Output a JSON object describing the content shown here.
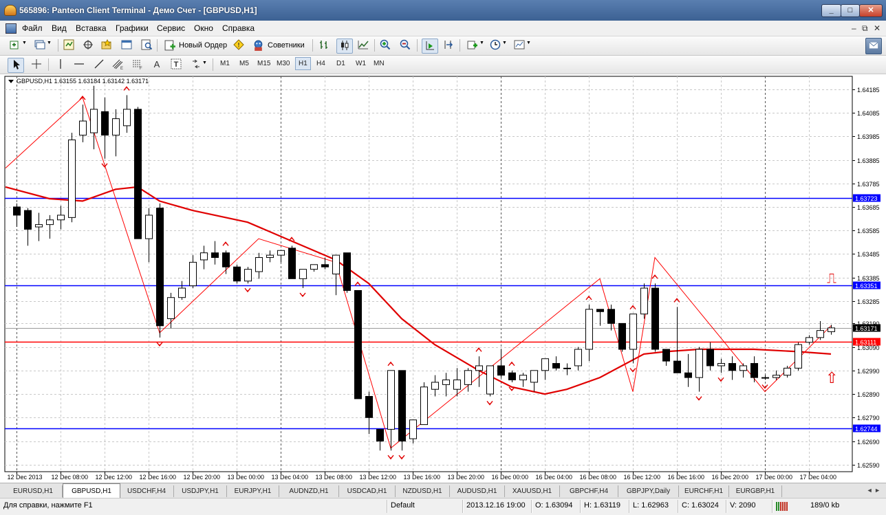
{
  "window": {
    "title": "565896: Panteon Client Terminal - Демо Счет - [GBPUSD,H1]"
  },
  "window_controls": {
    "minimize": "_",
    "maximize": "□",
    "close": "✕"
  },
  "menu": [
    "Файл",
    "Вид",
    "Вставка",
    "Графики",
    "Сервис",
    "Окно",
    "Справка"
  ],
  "mdi_controls": [
    "–",
    "⧉",
    "✕"
  ],
  "toolbar": {
    "new_order": "Новый Ордер",
    "advisors": "Советники"
  },
  "timeframes": [
    "M1",
    "M5",
    "M15",
    "M30",
    "H1",
    "H4",
    "D1",
    "W1",
    "MN"
  ],
  "active_timeframe": "H1",
  "chart_data": {
    "type": "candlestick",
    "header": "GBPUSD,H1  1.63155 1.63184 1.63142 1.63171",
    "price_ticks": [
      "1.64185",
      "1.64085",
      "1.63985",
      "1.63885",
      "1.63785",
      "1.63685",
      "1.63585",
      "1.63485",
      "1.63385",
      "1.63285",
      "1.63190",
      "1.63090",
      "1.62990",
      "1.62890",
      "1.62790",
      "1.62690",
      "1.62590"
    ],
    "x_labels": [
      "12 Dec 2013",
      "12 Dec 08:00",
      "12 Dec 12:00",
      "12 Dec 16:00",
      "12 Dec 20:00",
      "13 Dec 00:00",
      "13 Dec 04:00",
      "13 Dec 08:00",
      "13 Dec 12:00",
      "13 Dec 16:00",
      "13 Dec 20:00",
      "16 Dec 00:00",
      "16 Dec 04:00",
      "16 Dec 08:00",
      "16 Dec 12:00",
      "16 Dec 16:00",
      "16 Dec 20:00",
      "17 Dec 00:00",
      "17 Dec 04:00"
    ],
    "horizontal_lines": [
      {
        "price": 1.63723,
        "label": "1.63723",
        "color": "#0000ff"
      },
      {
        "price": 1.63351,
        "label": "1.63351",
        "color": "#0000ff"
      },
      {
        "price": 1.63111,
        "label": "1.63111",
        "color": "#ff0000"
      },
      {
        "price": 1.62744,
        "label": "1.62744",
        "color": "#0000ff"
      }
    ],
    "current_price": {
      "price": 1.63171,
      "label": "1.63171"
    },
    "ohlc": [
      [
        1.63685,
        1.637,
        1.636,
        1.6365
      ],
      [
        1.6367,
        1.6368,
        1.6352,
        1.6359
      ],
      [
        1.636,
        1.6366,
        1.6354,
        1.6361
      ],
      [
        1.6361,
        1.6365,
        1.6355,
        1.6363
      ],
      [
        1.6363,
        1.6369,
        1.6359,
        1.6365
      ],
      [
        1.6364,
        1.64,
        1.6362,
        1.6397
      ],
      [
        1.6399,
        1.6412,
        1.6396,
        1.6405
      ],
      [
        1.64,
        1.642,
        1.6393,
        1.641
      ],
      [
        1.6409,
        1.6415,
        1.6389,
        1.6399
      ],
      [
        1.6399,
        1.641,
        1.639,
        1.6406
      ],
      [
        1.6403,
        1.6416,
        1.64,
        1.641
      ],
      [
        1.641,
        1.6411,
        1.6355,
        1.6355
      ],
      [
        1.6355,
        1.6368,
        1.6345,
        1.6365
      ],
      [
        1.6368,
        1.637,
        1.6313,
        1.6318
      ],
      [
        1.6321,
        1.6332,
        1.6317,
        1.633
      ],
      [
        1.633,
        1.6337,
        1.6329,
        1.6334
      ],
      [
        1.6335,
        1.6348,
        1.6334,
        1.6345
      ],
      [
        1.6346,
        1.6352,
        1.6342,
        1.6349
      ],
      [
        1.6349,
        1.6354,
        1.6344,
        1.6347
      ],
      [
        1.6349,
        1.635,
        1.634,
        1.6343
      ],
      [
        1.6343,
        1.6344,
        1.6336,
        1.6337
      ],
      [
        1.6337,
        1.6343,
        1.6336,
        1.6342
      ],
      [
        1.6341,
        1.6349,
        1.6338,
        1.6347
      ],
      [
        1.6347,
        1.635,
        1.6345,
        1.6348
      ],
      [
        1.6348,
        1.6349,
        1.6345,
        1.635
      ],
      [
        1.6351,
        1.6352,
        1.6338,
        1.6338
      ],
      [
        1.6338,
        1.6342,
        1.6334,
        1.6342
      ],
      [
        1.6342,
        1.6344,
        1.6341,
        1.6344
      ],
      [
        1.6344,
        1.6347,
        1.6342,
        1.6343
      ],
      [
        1.634,
        1.6348,
        1.6331,
        1.6348
      ],
      [
        1.6349,
        1.6349,
        1.6332,
        1.6333
      ],
      [
        1.6333,
        1.6333,
        1.6287,
        1.6287
      ],
      [
        1.6288,
        1.629,
        1.6272,
        1.6279
      ],
      [
        1.6274,
        1.6274,
        1.6265,
        1.6269
      ],
      [
        1.6274,
        1.6299,
        1.6265,
        1.6299
      ],
      [
        1.6299,
        1.6299,
        1.6265,
        1.6269
      ],
      [
        1.627,
        1.6278,
        1.6268,
        1.6278
      ],
      [
        1.6276,
        1.6294,
        1.6276,
        1.6292
      ],
      [
        1.6291,
        1.6297,
        1.6288,
        1.6294
      ],
      [
        1.6293,
        1.6298,
        1.6288,
        1.6295
      ],
      [
        1.6291,
        1.63,
        1.6288,
        1.6295
      ],
      [
        1.6293,
        1.63,
        1.629,
        1.6299
      ],
      [
        1.6299,
        1.6305,
        1.6292,
        1.6301
      ],
      [
        1.6289,
        1.6301,
        1.6288,
        1.6301
      ],
      [
        1.6301,
        1.6308,
        1.6296,
        1.6297
      ],
      [
        1.6298,
        1.6299,
        1.6294,
        1.6295
      ],
      [
        1.6295,
        1.6298,
        1.6292,
        1.6297
      ],
      [
        1.6294,
        1.6299,
        1.629,
        1.6299
      ],
      [
        1.6299,
        1.6304,
        1.6295,
        1.6304
      ],
      [
        1.6302,
        1.6305,
        1.6299,
        1.63
      ],
      [
        1.63,
        1.6302,
        1.6297,
        1.63
      ],
      [
        1.6301,
        1.6309,
        1.6299,
        1.6308
      ],
      [
        1.6308,
        1.6327,
        1.6303,
        1.6325
      ],
      [
        1.6325,
        1.6325,
        1.6318,
        1.6324
      ],
      [
        1.6325,
        1.6327,
        1.6316,
        1.6319
      ],
      [
        1.6319,
        1.6319,
        1.6307,
        1.6308
      ],
      [
        1.6308,
        1.6323,
        1.6302,
        1.6323
      ],
      [
        1.6323,
        1.6336,
        1.6321,
        1.6334
      ],
      [
        1.6334,
        1.6336,
        1.6307,
        1.6308
      ],
      [
        1.6308,
        1.6308,
        1.6301,
        1.6303
      ],
      [
        1.6303,
        1.6326,
        1.6299,
        1.6298
      ],
      [
        1.6298,
        1.6306,
        1.6292,
        1.6296
      ],
      [
        1.6296,
        1.6309,
        1.629,
        1.6308
      ],
      [
        1.6308,
        1.6311,
        1.6299,
        1.6301
      ],
      [
        1.6301,
        1.6304,
        1.6298,
        1.6302
      ],
      [
        1.6302,
        1.6305,
        1.6295,
        1.6299
      ],
      [
        1.6299,
        1.6302,
        1.6296,
        1.6301
      ],
      [
        1.6302,
        1.6305,
        1.6294,
        1.6296
      ],
      [
        1.6296,
        1.6297,
        1.6295,
        1.6296
      ],
      [
        1.6296,
        1.6299,
        1.6295,
        1.6297
      ],
      [
        1.6297,
        1.6301,
        1.6296,
        1.63
      ],
      [
        1.63,
        1.6311,
        1.6299,
        1.631
      ],
      [
        1.6311,
        1.6314,
        1.631,
        1.6313
      ],
      [
        1.6313,
        1.632,
        1.6312,
        1.6316
      ],
      [
        1.63155,
        1.63184,
        1.63142,
        1.63171
      ]
    ],
    "zigzag": [
      [
        -1,
        1.6385
      ],
      [
        6,
        1.6415
      ],
      [
        13,
        1.6315
      ],
      [
        22,
        1.6355
      ],
      [
        29,
        1.6345
      ],
      [
        34,
        1.6266
      ],
      [
        53,
        1.6338
      ],
      [
        56,
        1.629
      ],
      [
        58,
        1.6347
      ],
      [
        68,
        1.629
      ],
      [
        74,
        1.6318
      ]
    ],
    "moving_average": [
      [
        -1,
        1.6377
      ],
      [
        3,
        1.6372
      ],
      [
        6,
        1.6371
      ],
      [
        9,
        1.6376
      ],
      [
        11,
        1.6377
      ],
      [
        13,
        1.6371
      ],
      [
        16,
        1.6367
      ],
      [
        21,
        1.6362
      ],
      [
        25,
        1.6354
      ],
      [
        29,
        1.6346
      ],
      [
        32,
        1.6336
      ],
      [
        35,
        1.6321
      ],
      [
        38,
        1.631
      ],
      [
        42,
        1.6299
      ],
      [
        45,
        1.6292
      ],
      [
        48,
        1.6289
      ],
      [
        50,
        1.6291
      ],
      [
        53,
        1.6296
      ],
      [
        55,
        1.6301
      ],
      [
        57,
        1.6306
      ],
      [
        59,
        1.6307
      ],
      [
        62,
        1.6308
      ],
      [
        67,
        1.6308
      ],
      [
        71,
        1.6307
      ],
      [
        74,
        1.6306
      ]
    ],
    "fractals": {
      "up": [
        6,
        10,
        19,
        25,
        31,
        34,
        42,
        45,
        52,
        56,
        58,
        60
      ],
      "down": [
        8,
        13,
        21,
        26,
        34,
        35,
        43,
        45,
        56,
        62,
        64,
        68
      ]
    },
    "sell_stop": "⎍",
    "buy_arrow": "⇧"
  },
  "tabs": [
    "EURUSD,H1",
    "GBPUSD,H1",
    "USDCHF,H4",
    "USDJPY,H1",
    "EURJPY,H1",
    "AUDNZD,H1",
    "USDCAD,H1",
    "NZDUSD,H1",
    "AUDUSD,H1",
    "XAUUSD,H1",
    "GBPCHF,H4",
    "GBPJPY,Daily",
    "EURCHF,H1",
    "EURGBP,H1"
  ],
  "active_tab": "GBPUSD,H1",
  "tab_nav": "◄ ►",
  "status": {
    "help": "Для справки, нажмите F1",
    "profile": "Default",
    "time": "2013.12.16 19:00",
    "open": "O: 1.63094",
    "high": "H: 1.63119",
    "low": "L: 1.62963",
    "close": "C: 1.63024",
    "volume": "V: 2090",
    "traffic": "189/0 kb"
  },
  "colors": {
    "up_line": "#0000ff",
    "sell_line": "#ff0000",
    "zigzag": "#ff0000",
    "ma": "#e00000",
    "grid": "#c8c8c8"
  }
}
